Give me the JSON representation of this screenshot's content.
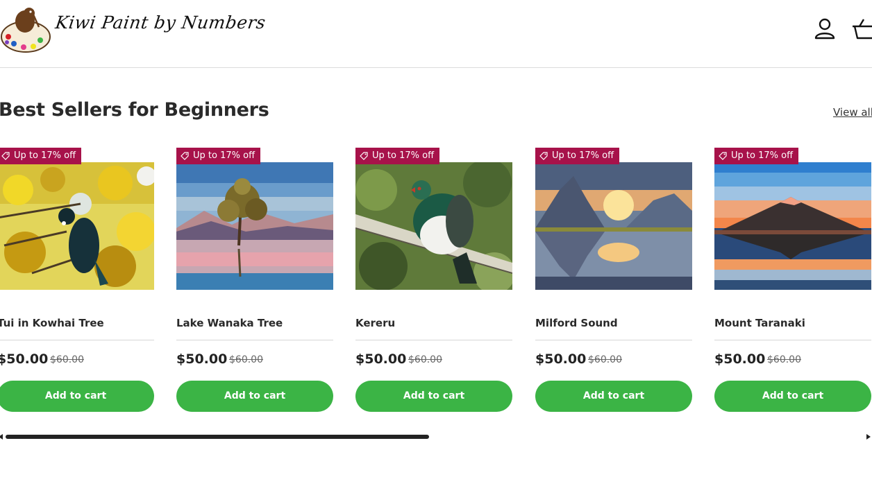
{
  "header": {
    "brand": "Kiwi Paint by Numbers",
    "logo_icon": "kiwi-palette-logo",
    "account_icon": "account-icon",
    "cart_icon": "basket-icon"
  },
  "section": {
    "title": "Best Sellers for Beginners",
    "view_all": "View all"
  },
  "products": [
    {
      "badge": "Up to 17% off",
      "title": "Tui in Kowhai Tree",
      "price": "$50.00",
      "compare_price": "$60.00",
      "cta": "Add to cart",
      "image": "tui-bird-painting"
    },
    {
      "badge": "Up to 17% off",
      "title": "Lake Wanaka Tree",
      "price": "$50.00",
      "compare_price": "$60.00",
      "cta": "Add to cart",
      "image": "lake-tree-painting"
    },
    {
      "badge": "Up to 17% off",
      "title": "Kereru",
      "price": "$50.00",
      "compare_price": "$60.00",
      "cta": "Add to cart",
      "image": "pigeon-painting"
    },
    {
      "badge": "Up to 17% off",
      "title": "Milford Sound",
      "price": "$50.00",
      "compare_price": "$60.00",
      "cta": "Add to cart",
      "image": "fjord-painting"
    },
    {
      "badge": "Up to 17% off",
      "title": "Mount Taranaki",
      "price": "$50.00",
      "compare_price": "$60.00",
      "cta": "Add to cart",
      "image": "volcano-painting"
    }
  ],
  "colors": {
    "badge": "#a7124a",
    "button": "#3bb445"
  },
  "scroll": {
    "position": 0.5
  }
}
